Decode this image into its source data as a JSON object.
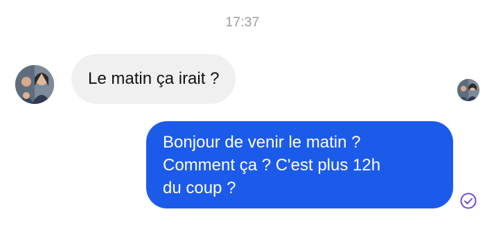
{
  "conversation": {
    "timestamp": "17:37",
    "messages": [
      {
        "direction": "incoming",
        "lines": [
          "Le matin ça irait ?"
        ]
      },
      {
        "direction": "outgoing",
        "lines": [
          "Bonjour de venir le matin ?",
          "Comment ça ? C'est plus 12h",
          "du coup ?"
        ]
      }
    ]
  },
  "icons": {
    "contact_avatar": "contact-avatar-photo",
    "read_receipt_avatar": "read-receipt-avatar-photo",
    "sent_status": "check-circle-icon"
  },
  "colors": {
    "outgoing_bubble": "#1c5bea",
    "incoming_bubble": "#f0f0f0",
    "timestamp_text": "#9a9a9a",
    "sent_status": "#6a4be0"
  }
}
